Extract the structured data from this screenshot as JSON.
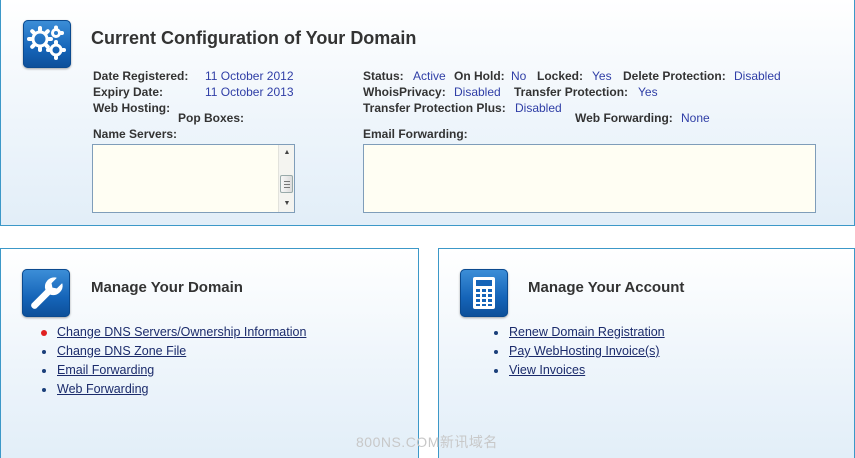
{
  "config": {
    "title": "Current Configuration of Your Domain",
    "date_registered_label": "Date Registered:",
    "date_registered": "11 October 2012",
    "expiry_date_label": "Expiry Date:",
    "expiry_date": "11 October 2013",
    "web_hosting_label": "Web Hosting:",
    "pop_boxes_label": "Pop Boxes:",
    "name_servers_label": "Name Servers:",
    "status_label": "Status:",
    "status": "Active",
    "on_hold_label": "On Hold:",
    "on_hold": "No",
    "locked_label": "Locked:",
    "locked": "Yes",
    "delete_protection_label": "Delete Protection:",
    "delete_protection": "Disabled",
    "whois_privacy_label": "WhoisPrivacy:",
    "whois_privacy": "Disabled",
    "transfer_protection_label": "Transfer Protection:",
    "transfer_protection": "Yes",
    "transfer_protection_plus_label": "Transfer Protection Plus:",
    "transfer_protection_plus": "Disabled",
    "web_forwarding_label": "Web Forwarding:",
    "web_forwarding": "None",
    "email_forwarding_label": "Email Forwarding:",
    "icon": "gears-icon"
  },
  "manage_domain": {
    "title": "Manage Your Domain",
    "icon": "wrench-icon",
    "links": [
      "Change DNS Servers/Ownership Information",
      "Change DNS Zone File",
      "Email Forwarding",
      "Web Forwarding"
    ]
  },
  "manage_account": {
    "title": "Manage Your Account",
    "icon": "calculator-icon",
    "links": [
      "Renew Domain Registration",
      "Pay WebHosting Invoice(s)",
      "View Invoices"
    ]
  },
  "colors": {
    "border": "#3c98c8",
    "value_text": "#2f3ea6",
    "link_text": "#1b2b6b",
    "active_bullet": "#e02020"
  },
  "watermark": "800NS.COM新讯域名"
}
